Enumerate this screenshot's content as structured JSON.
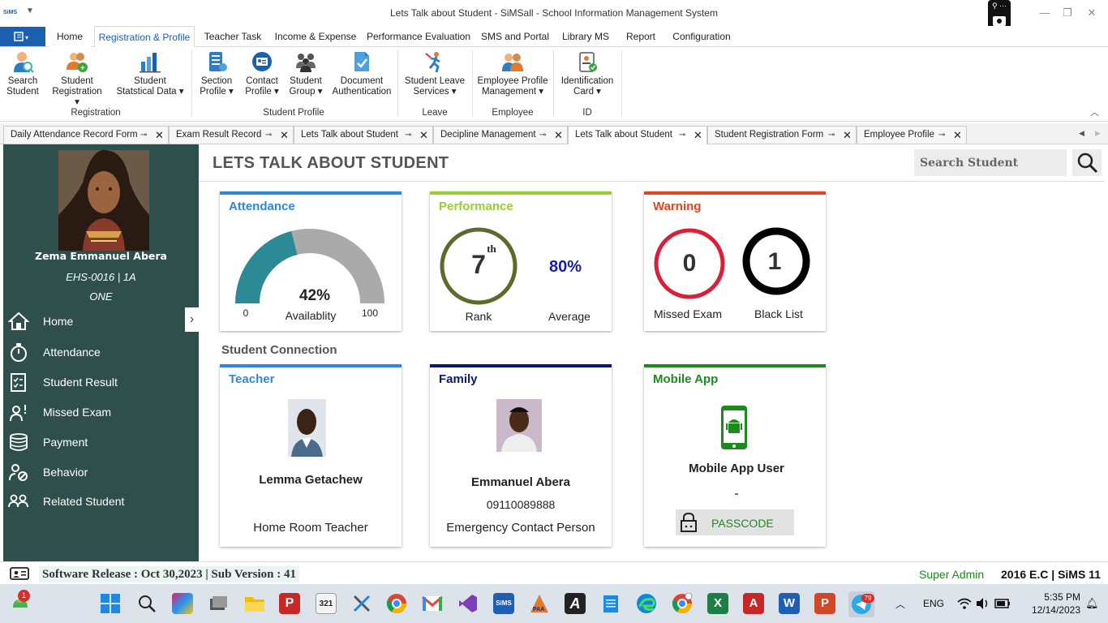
{
  "app": {
    "logo_text": "SiMS",
    "window_title": "Lets Talk about Student - SiMSall - School Information Management System"
  },
  "ribbon": {
    "file_label": "",
    "tabs": [
      "Home",
      "Registration & Profile",
      "Teacher Task",
      "Income & Expense",
      "Performance Evaluation",
      "SMS and Portal",
      "Library MS",
      "Report",
      "Configuration"
    ],
    "buttons": [
      {
        "l1": "Search",
        "l2": "Student"
      },
      {
        "l1": "Student",
        "l2": "Registration ▾"
      },
      {
        "l1": "Student",
        "l2": "Statstical Data ▾"
      },
      {
        "l1": "Section",
        "l2": "Profile ▾"
      },
      {
        "l1": "Contact",
        "l2": "Profile ▾"
      },
      {
        "l1": "Student",
        "l2": "Group ▾"
      },
      {
        "l1": "Document",
        "l2": "Authentication"
      },
      {
        "l1": "Student Leave",
        "l2": "Services ▾"
      },
      {
        "l1": "Employee Profile",
        "l2": "Management ▾"
      },
      {
        "l1": "Identification",
        "l2": "Card ▾"
      }
    ],
    "groups": [
      "Registration",
      "Student Profile",
      "Leave",
      "Employee",
      "ID"
    ]
  },
  "doc_tabs": [
    "Daily Attendance Record Form",
    "Exam Result Record",
    "Lets Talk about Student",
    "Decipline Management",
    "Lets Talk about Student",
    "Student Registration Form",
    "Employee Profile"
  ],
  "sidebar": {
    "student_name": "Zema Emmanuel Abera",
    "student_id": "EHS-0016  |  1A",
    "student_grade": "ONE",
    "items": [
      "Home",
      "Attendance",
      "Student Result",
      "Missed Exam",
      "Payment",
      "Behavior",
      "Related Student"
    ]
  },
  "main": {
    "title": "LETS TALK ABOUT STUDENT",
    "search_placeholder": "Search Student",
    "section_label": "Student Connection"
  },
  "attendance": {
    "title": "Attendance",
    "percent": 42,
    "percent_label": "42%",
    "caption": "Availablity",
    "min_label": "0",
    "max_label": "100",
    "fill_color": "#2b8a96",
    "track_color": "#aaaaaa",
    "accent": "#2e86de"
  },
  "performance": {
    "title": "Performance",
    "rank": "7",
    "rank_suffix": "th",
    "rank_label": "Rank",
    "average": "80%",
    "average_label": "Average",
    "accent": "#9acd32"
  },
  "warning": {
    "title": "Warning",
    "missed_count": "0",
    "missed_label": "Missed Exam",
    "blacklist_count": "1",
    "blacklist_label": "Black List",
    "accent": "#e8441a"
  },
  "teacher": {
    "title": "Teacher",
    "name": "Lemma Getachew",
    "role": "Home Room Teacher",
    "accent": "#2e86de"
  },
  "family": {
    "title": "Family",
    "name": "Emmanuel Abera",
    "phone": "09110089888",
    "role": "Emergency Contact Person",
    "accent": "#0a1a6e"
  },
  "mobile": {
    "title": "Mobile App",
    "status": "Mobile App User",
    "value": "-",
    "passcode_label": "PASSCODE",
    "accent": "#1e8a1e"
  },
  "statusbar": {
    "release": "Software Release : Oct 30,2023 | Sub Version : 41",
    "user_role": "Super Admin",
    "version": "2016 E.C | SiMS 11"
  },
  "taskbar": {
    "lang": "ENG",
    "time": "5:35 PM",
    "date": "12/14/2023",
    "telegram_badge": "79",
    "notif_badge": "1"
  }
}
